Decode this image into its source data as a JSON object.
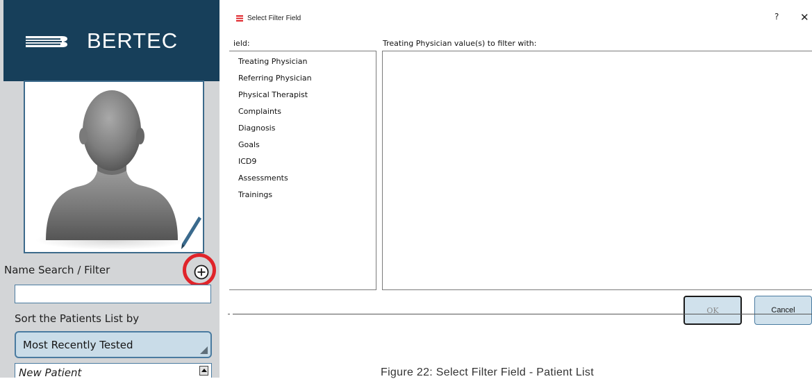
{
  "brand": {
    "name": "BERTEC",
    "logo_icon": "bertec-stripes-logo",
    "bar_color": "#173f5a"
  },
  "patient_panel": {
    "photo_icon": "head-silhouette-icon",
    "edit_icon": "pencil-icon",
    "name_search_label": "Name Search / Filter",
    "add_filter_icon": "plus-circle-icon",
    "highlight_color": "#e0242a",
    "name_search_value": "",
    "sort_label": "Sort the Patients List by",
    "sort_value": "Most Recently Tested",
    "patients": [
      "New Patient"
    ]
  },
  "dialog": {
    "title": "Select Filter Field",
    "help_label": "?",
    "close_label": "✕",
    "field_label": "ield:",
    "fields": [
      "Treating Physician",
      "Referring Physician",
      "Physical Therapist",
      "Complaints",
      "Diagnosis",
      "Goals",
      "ICD9",
      "Assessments",
      "Trainings"
    ],
    "value_label": "Treating Physician value(s) to filter with:",
    "values": [],
    "ok_label": "OK",
    "cancel_label": "Cancel"
  },
  "caption": "Figure 22:  Select Filter Field - Patient List"
}
